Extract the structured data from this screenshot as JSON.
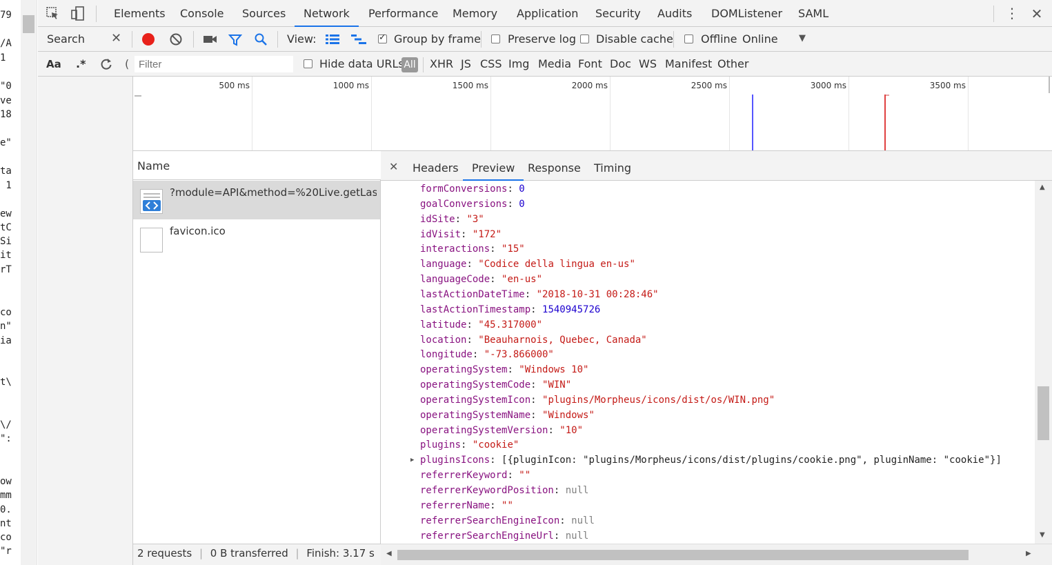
{
  "left_strip_lines": [
    "79",
    "/A",
    "1",
    "\"0",
    "ve",
    "18",
    "e\"",
    "ta",
    " 1",
    "ew",
    "tC",
    "Si",
    "it",
    "rT",
    "co",
    "n\"",
    "ia",
    "t\\",
    "\\/",
    "\":",
    "ow",
    "mm",
    "0.",
    "nt",
    "co",
    "\"r"
  ],
  "tabs": [
    "Elements",
    "Console",
    "Sources",
    "Network",
    "Performance",
    "Memory",
    "Application",
    "Security",
    "Audits",
    "DOMListener",
    "SAML"
  ],
  "search_panel": {
    "label": "Search"
  },
  "toolbar": {
    "view_label": "View:",
    "group_by_frame": "Group by frame",
    "preserve_log": "Preserve log",
    "disable_cache": "Disable cache",
    "offline": "Offline",
    "throttle": "Online"
  },
  "filterbar": {
    "case_label": "Aa",
    "regex_label": ".*",
    "filter_placeholder": "Filter",
    "hide_data_urls": "Hide data URLs",
    "all": "All",
    "types": [
      "XHR",
      "JS",
      "CSS",
      "Img",
      "Media",
      "Font",
      "Doc",
      "WS",
      "Manifest",
      "Other"
    ]
  },
  "overview": {
    "ticks": [
      "500 ms",
      "1000 ms",
      "1500 ms",
      "2000 ms",
      "2500 ms",
      "3000 ms",
      "3500 ms"
    ],
    "dom_content_loaded_color": "#5555ff",
    "load_color": "#e04040"
  },
  "names_panel": {
    "header": "Name",
    "requests": [
      {
        "name": "?module=API&method=%20Live.getLas...",
        "icon": "code-file-icon"
      },
      {
        "name": "favicon.ico",
        "icon": "blank-file-icon"
      }
    ]
  },
  "statusbar": {
    "requests": "2 requests",
    "transferred": "0 B transferred",
    "finish": "Finish: 3.17 s",
    "more": "…"
  },
  "detail_tabs": [
    "Headers",
    "Preview",
    "Response",
    "Timing"
  ],
  "preview_lines": [
    {
      "key": "formConversions",
      "value": "0",
      "type": "num"
    },
    {
      "key": "goalConversions",
      "value": "0",
      "type": "num"
    },
    {
      "key": "idSite",
      "value": "\"3\"",
      "type": "str"
    },
    {
      "key": "idVisit",
      "value": "\"172\"",
      "type": "str"
    },
    {
      "key": "interactions",
      "value": "\"15\"",
      "type": "str"
    },
    {
      "key": "language",
      "value": "\"Codice della lingua en-us\"",
      "type": "str"
    },
    {
      "key": "languageCode",
      "value": "\"en-us\"",
      "type": "str"
    },
    {
      "key": "lastActionDateTime",
      "value": "\"2018-10-31 00:28:46\"",
      "type": "str"
    },
    {
      "key": "lastActionTimestamp",
      "value": "1540945726",
      "type": "num"
    },
    {
      "key": "latitude",
      "value": "\"45.317000\"",
      "type": "str"
    },
    {
      "key": "location",
      "value": "\"Beauharnois, Quebec, Canada\"",
      "type": "str"
    },
    {
      "key": "longitude",
      "value": "\"-73.866000\"",
      "type": "str"
    },
    {
      "key": "operatingSystem",
      "value": "\"Windows 10\"",
      "type": "str"
    },
    {
      "key": "operatingSystemCode",
      "value": "\"WIN\"",
      "type": "str"
    },
    {
      "key": "operatingSystemIcon",
      "value": "\"plugins/Morpheus/icons/dist/os/WIN.png\"",
      "type": "str"
    },
    {
      "key": "operatingSystemName",
      "value": "\"Windows\"",
      "type": "str"
    },
    {
      "key": "operatingSystemVersion",
      "value": "\"10\"",
      "type": "str"
    },
    {
      "key": "plugins",
      "value": "\"cookie\"",
      "type": "str"
    },
    {
      "key": "pluginsIcons",
      "value": "[{pluginIcon: \"plugins/Morpheus/icons/dist/plugins/cookie.png\", pluginName: \"cookie\"}]",
      "type": "plain",
      "expandable": true
    },
    {
      "key": "referrerKeyword",
      "value": "\"\"",
      "type": "str"
    },
    {
      "key": "referrerKeywordPosition",
      "value": "null",
      "type": "null"
    },
    {
      "key": "referrerName",
      "value": "\"\"",
      "type": "str"
    },
    {
      "key": "referrerSearchEngineIcon",
      "value": "null",
      "type": "null"
    },
    {
      "key": "referrerSearchEngineUrl",
      "value": "null",
      "type": "null"
    }
  ]
}
